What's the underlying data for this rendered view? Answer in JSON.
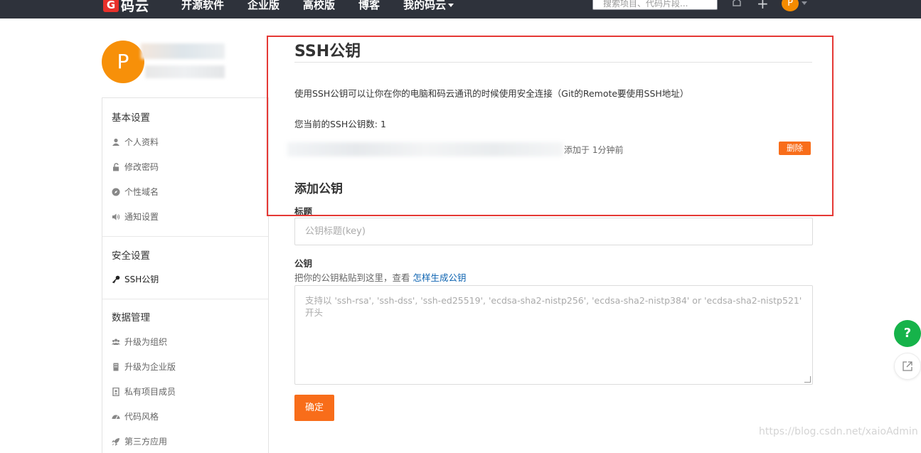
{
  "header": {
    "logo_mark": "G",
    "logo_text": "码云",
    "nav": [
      "开源软件",
      "企业版",
      "高校版",
      "博客",
      "我的码云"
    ],
    "search_placeholder": "搜索项目、代码片段...",
    "avatar_letter": "P"
  },
  "profile": {
    "avatar_letter": "P"
  },
  "sidebar": {
    "sections": [
      {
        "title": "基本设置",
        "items": [
          "个人资料",
          "修改密码",
          "个性域名",
          "通知设置"
        ]
      },
      {
        "title": "安全设置",
        "items": [
          "SSH公钥"
        ]
      },
      {
        "title": "数据管理",
        "items": [
          "升级为组织",
          "升级为企业版",
          "私有项目成员",
          "代码风格",
          "第三方应用"
        ]
      }
    ]
  },
  "main": {
    "title": "SSH公钥",
    "description": "使用SSH公钥可以让你在你的电脑和码云通讯的时候使用安全连接（Git的Remote要使用SSH地址）",
    "count_label": "您当前的SSH公钥数: 1",
    "key": {
      "added": "添加于 1分钟前",
      "delete_label": "删除"
    },
    "add_title": "添加公钥",
    "form": {
      "title_label": "标题",
      "title_placeholder": "公钥标题(key)",
      "key_label": "公钥",
      "key_hint": "把你的公钥粘贴到这里，查看",
      "key_hint_link": "怎样生成公钥",
      "key_placeholder": "支持以 'ssh-rsa', 'ssh-dss', 'ssh-ed25519', 'ecdsa-sha2-nistp256', 'ecdsa-sha2-nistp384' or 'ecdsa-sha2-nistp521' 开头",
      "submit_label": "确定"
    }
  },
  "floating": {
    "help_label": "?"
  },
  "watermark": "https://blog.csdn.net/xaioAdmin",
  "colors": {
    "accent": "#f86d1a",
    "highlight": "#e53935",
    "help": "#16b34a",
    "nav_bg": "#2e323b"
  }
}
